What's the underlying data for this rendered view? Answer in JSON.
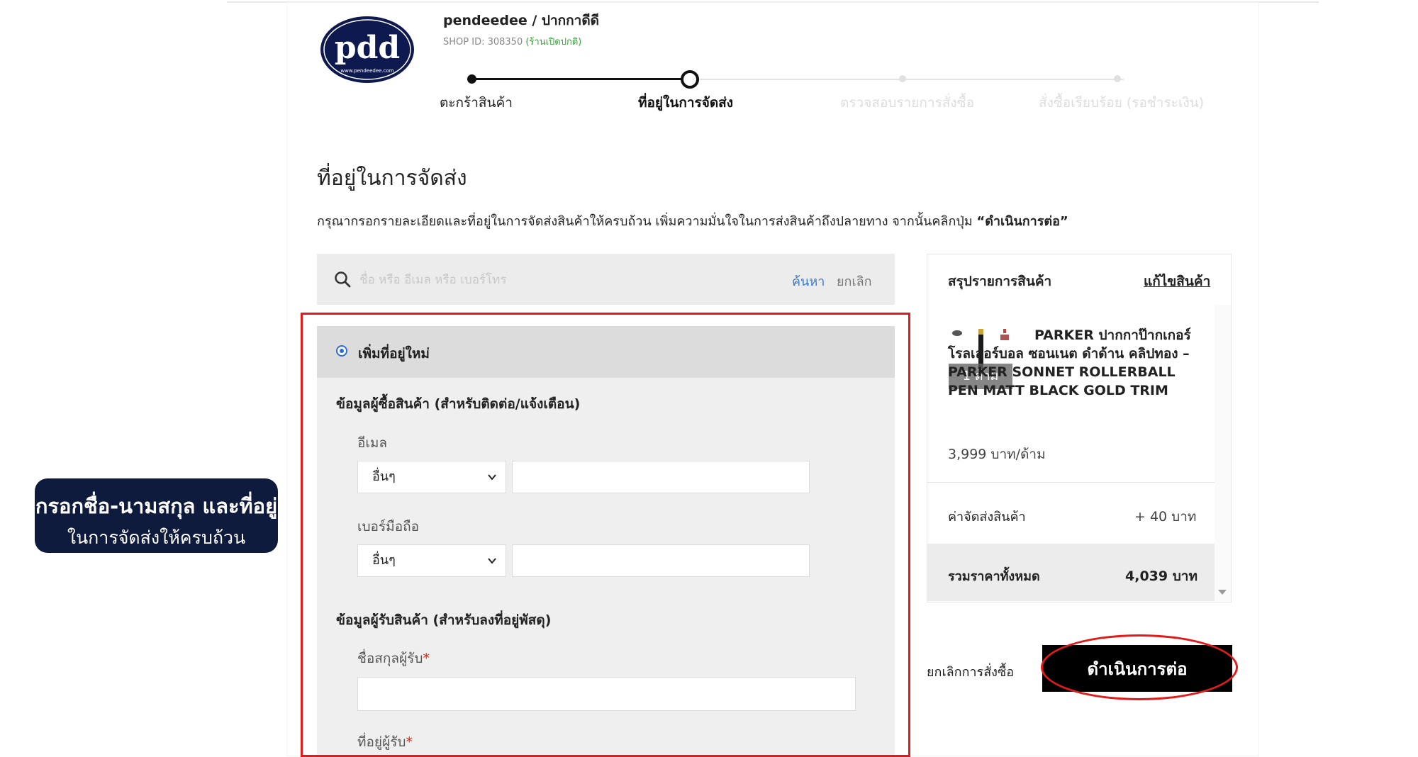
{
  "shop": {
    "name": "pendeedee / ปากกาดีดี",
    "id_label": "SHOP ID: 308350",
    "status": "(ร้านเปิดปกติ)",
    "logo_text": "pdd",
    "logo_subtext": "www.pendeedee.com"
  },
  "steps": [
    {
      "label": "ตะกร้าสินค้า",
      "state": "done"
    },
    {
      "label": "ที่อยู่ในการจัดส่ง",
      "state": "current"
    },
    {
      "label": "ตรวจสอบรายการสั่งซื้อ",
      "state": "todo"
    },
    {
      "label": "สั่งซื้อเรียบร้อย (รอชำระเงิน)",
      "state": "todo"
    }
  ],
  "page": {
    "title": "ที่อยู่ในการจัดส่ง",
    "instructions": "กรุณากรอกรายละเอียดและที่อยู่ในการจัดส่งสินค้าให้ครบถ้วน เพิ่มความมั่นใจในการส่งสินค้าถึงปลายทาง จากนั้นคลิกปุ่ม ",
    "instructions_button": "“ดำเนินการต่อ”"
  },
  "search": {
    "placeholder": "ชื่อ หรือ อีเมล หรือ เบอร์โทร",
    "search_label": "ค้นหา",
    "cancel_label": "ยกเลิก"
  },
  "form": {
    "new_address_label": "เพิ่มที่อยู่ใหม่",
    "buyer_section": "ข้อมูลผู้ซื้อสินค้า (สำหรับติดต่อ/แจ้งเตือน)",
    "email_label": "อีเมล",
    "email_type": "อื่นๆ",
    "email_value": "",
    "phone_label": "เบอร์มือถือ",
    "phone_type": "อื่นๆ",
    "phone_value": "",
    "recipient_section": "ข้อมูลผู้รับสินค้า (สำหรับลงที่อยู่พัสดุ)",
    "recipient_name_label": "ชื่อสกุลผู้รับ",
    "recipient_name_value": "",
    "recipient_address_label": "ที่อยู่ผู้รับ",
    "required_mark": "*"
  },
  "callout": {
    "line1": "กรอกชื่อ-นามสกุล และที่อยู่",
    "line2": "ในการจัดส่งให้ครบถ้วน"
  },
  "summary": {
    "title": "สรุปรายการสินค้า",
    "edit_label": "แก้ไขสินค้า",
    "item": {
      "name": "PARKER ปากกาป๊ากเกอร์ โรลเลอร์บอล ซอนเนต ดำด้าน คลิปทอง – PARKER SONNET ROLLERBALL PEN MATT BLACK GOLD TRIM",
      "qty": "1 ด้าม",
      "price": "3,999 บาท/ด้าม"
    },
    "shipping_label": "ค่าจัดส่งสินค้า",
    "shipping_value": "+ 40 บาท",
    "total_label": "รวมราคาทั้งหมด",
    "total_value": "4,039 บาท"
  },
  "actions": {
    "cancel_order": "ยกเลิกการสั่งซื้อ",
    "continue": "ดำเนินการต่อ"
  },
  "colors": {
    "accent_link": "#3a78c3",
    "annotation_red": "#e01b1b",
    "callout_bg": "#0f1b3d",
    "status_green": "#3aa13a"
  }
}
